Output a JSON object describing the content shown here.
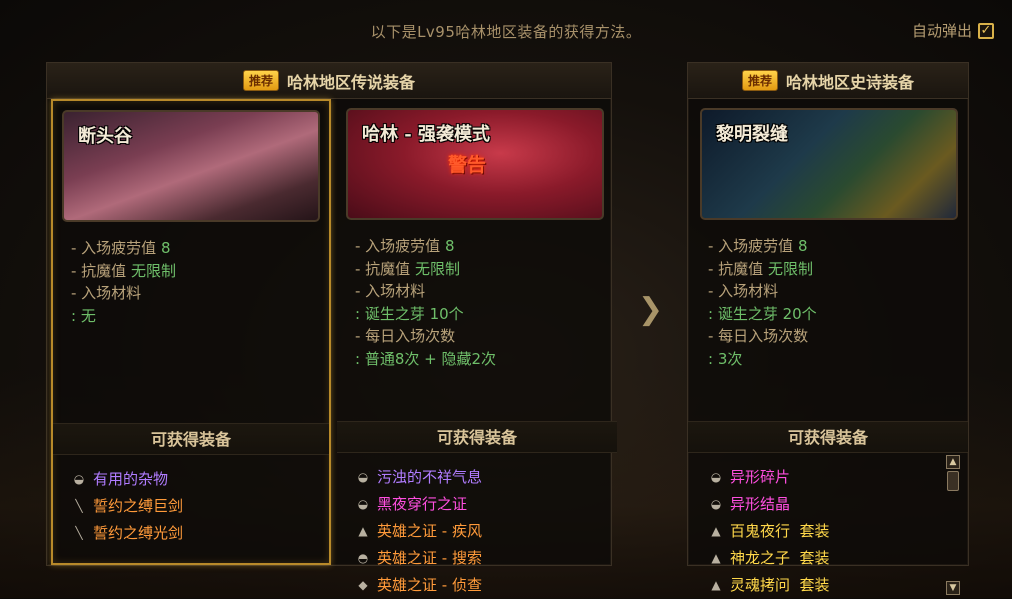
{
  "header": {
    "title": "以下是Lv95哈林地区装备的获得方法。",
    "auto_popup_label": "自动弹出",
    "auto_popup_checked": true
  },
  "legend_panel": {
    "badge": "推荐",
    "title": "哈林地区传说装备",
    "columns": [
      {
        "thumb_title": "断头谷",
        "info": [
          {
            "k": "- 入场疲劳值 ",
            "v": "8"
          },
          {
            "k": "- 抗魔值 ",
            "v": "无限制"
          },
          {
            "k": "- 入场材料",
            "v": ""
          },
          {
            "k": "",
            "v": " : 无"
          }
        ],
        "section_title": "可获得装备",
        "items": [
          {
            "icon": "stone-icon",
            "glyph": "◒",
            "label": "有用的杂物",
            "color": "#b07cff"
          },
          {
            "icon": "sword-icon",
            "glyph": "╲",
            "label": "誓约之缚巨剑",
            "color": "#ff9a3a"
          },
          {
            "icon": "sword-icon",
            "glyph": "╲",
            "label": "誓约之缚光剑",
            "color": "#ff9a3a"
          }
        ]
      },
      {
        "thumb_title": "哈林 - 强袭模式",
        "thumb_warning": "警告",
        "info": [
          {
            "k": "- 入场疲劳值 ",
            "v": "8"
          },
          {
            "k": "- 抗魔值 ",
            "v": "无限制"
          },
          {
            "k": "- 入场材料",
            "v": ""
          },
          {
            "k": "",
            "v": " : 诞生之芽 10个"
          },
          {
            "k": "- 每日入场次数",
            "v": ""
          },
          {
            "k": "",
            "v": " : 普通8次 + 隐藏2次"
          }
        ],
        "section_title": "可获得装备",
        "items": [
          {
            "icon": "stone-icon",
            "glyph": "◒",
            "label": "污浊的不祥气息",
            "color": "#b07cff"
          },
          {
            "icon": "stone-icon",
            "glyph": "◒",
            "label": "黑夜穿行之证",
            "color": "#ff4fe0"
          },
          {
            "icon": "armor-icon",
            "glyph": "▲",
            "label": "英雄之证 - 疾风",
            "color": "#ff9a3a"
          },
          {
            "icon": "ring-icon",
            "glyph": "◓",
            "label": "英雄之证 - 搜索",
            "color": "#ff9a3a"
          },
          {
            "icon": "gem-icon",
            "glyph": "◆",
            "label": "英雄之证 - 侦查",
            "color": "#ff9a3a"
          }
        ]
      }
    ]
  },
  "epic_panel": {
    "badge": "推荐",
    "title": "哈林地区史诗装备",
    "column": {
      "thumb_title": "黎明裂缝",
      "info": [
        {
          "k": "- 入场疲劳值 ",
          "v": "8"
        },
        {
          "k": "- 抗魔值 ",
          "v": "无限制"
        },
        {
          "k": "- 入场材料",
          "v": ""
        },
        {
          "k": "",
          "v": " : 诞生之芽 20个"
        },
        {
          "k": "- 每日入场次数",
          "v": ""
        },
        {
          "k": "",
          "v": " : 3次"
        }
      ],
      "section_title": "可获得装备",
      "items": [
        {
          "icon": "stone-icon",
          "glyph": "◒",
          "label": "异形碎片",
          "color": "#ff4fe0"
        },
        {
          "icon": "stone-icon",
          "glyph": "◒",
          "label": "异形结晶",
          "color": "#ff4fe0"
        },
        {
          "icon": "armor-icon",
          "glyph": "▲",
          "label": "百鬼夜行  套装",
          "color": "#ffd84a"
        },
        {
          "icon": "armor-icon",
          "glyph": "▲",
          "label": "神龙之子  套装",
          "color": "#ffd84a"
        },
        {
          "icon": "armor-icon",
          "glyph": "▲",
          "label": "灵魂拷问  套装",
          "color": "#ffd84a"
        }
      ]
    }
  },
  "nav": {
    "next_glyph": "❯",
    "scroll_up": "▲",
    "scroll_down": "▼"
  }
}
